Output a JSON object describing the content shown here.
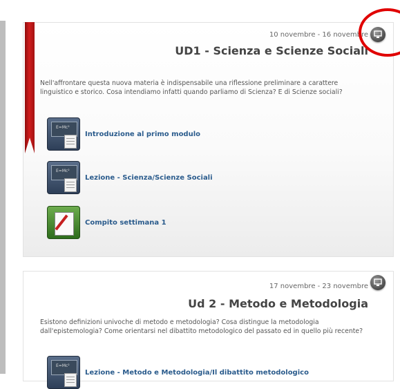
{
  "sections": [
    {
      "date": "10 novembre - 16 novembre",
      "title": "UD1 - Scienza e Scienze Sociali",
      "description": "Nell'affrontare questa nuova materia è indispensabile una riflessione preliminare a carattere linguistico e storico. Cosa intendiamo infatti quando parliamo di Scienza? E di Scienze sociali?",
      "activities": [
        {
          "label": "Introduzione al primo modulo",
          "icon": "lesson-icon"
        },
        {
          "label": "Lezione - Scienza/Scienze Sociali",
          "icon": "lesson-icon"
        },
        {
          "label": "Compito settimana 1",
          "icon": "assignment-icon"
        }
      ]
    },
    {
      "date": "17 novembre - 23 novembre",
      "title": "Ud 2 - Metodo e Metodologia",
      "description": "Esistono definizioni univoche di metodo e metodologia? Cosa distingue la metodologia dall'epistemologia? Come orientarsi nel dibattito metodologico del passato ed in quello più recente?",
      "activities": [
        {
          "label": "Lezione - Metodo e Metodologia/Il dibattito metodologico",
          "icon": "lesson-icon"
        }
      ]
    }
  ],
  "board_text": "E=Mc²",
  "colors": {
    "link": "#2a5b8c",
    "ribbon": "#c81a1a",
    "annotation": "#e00000"
  }
}
